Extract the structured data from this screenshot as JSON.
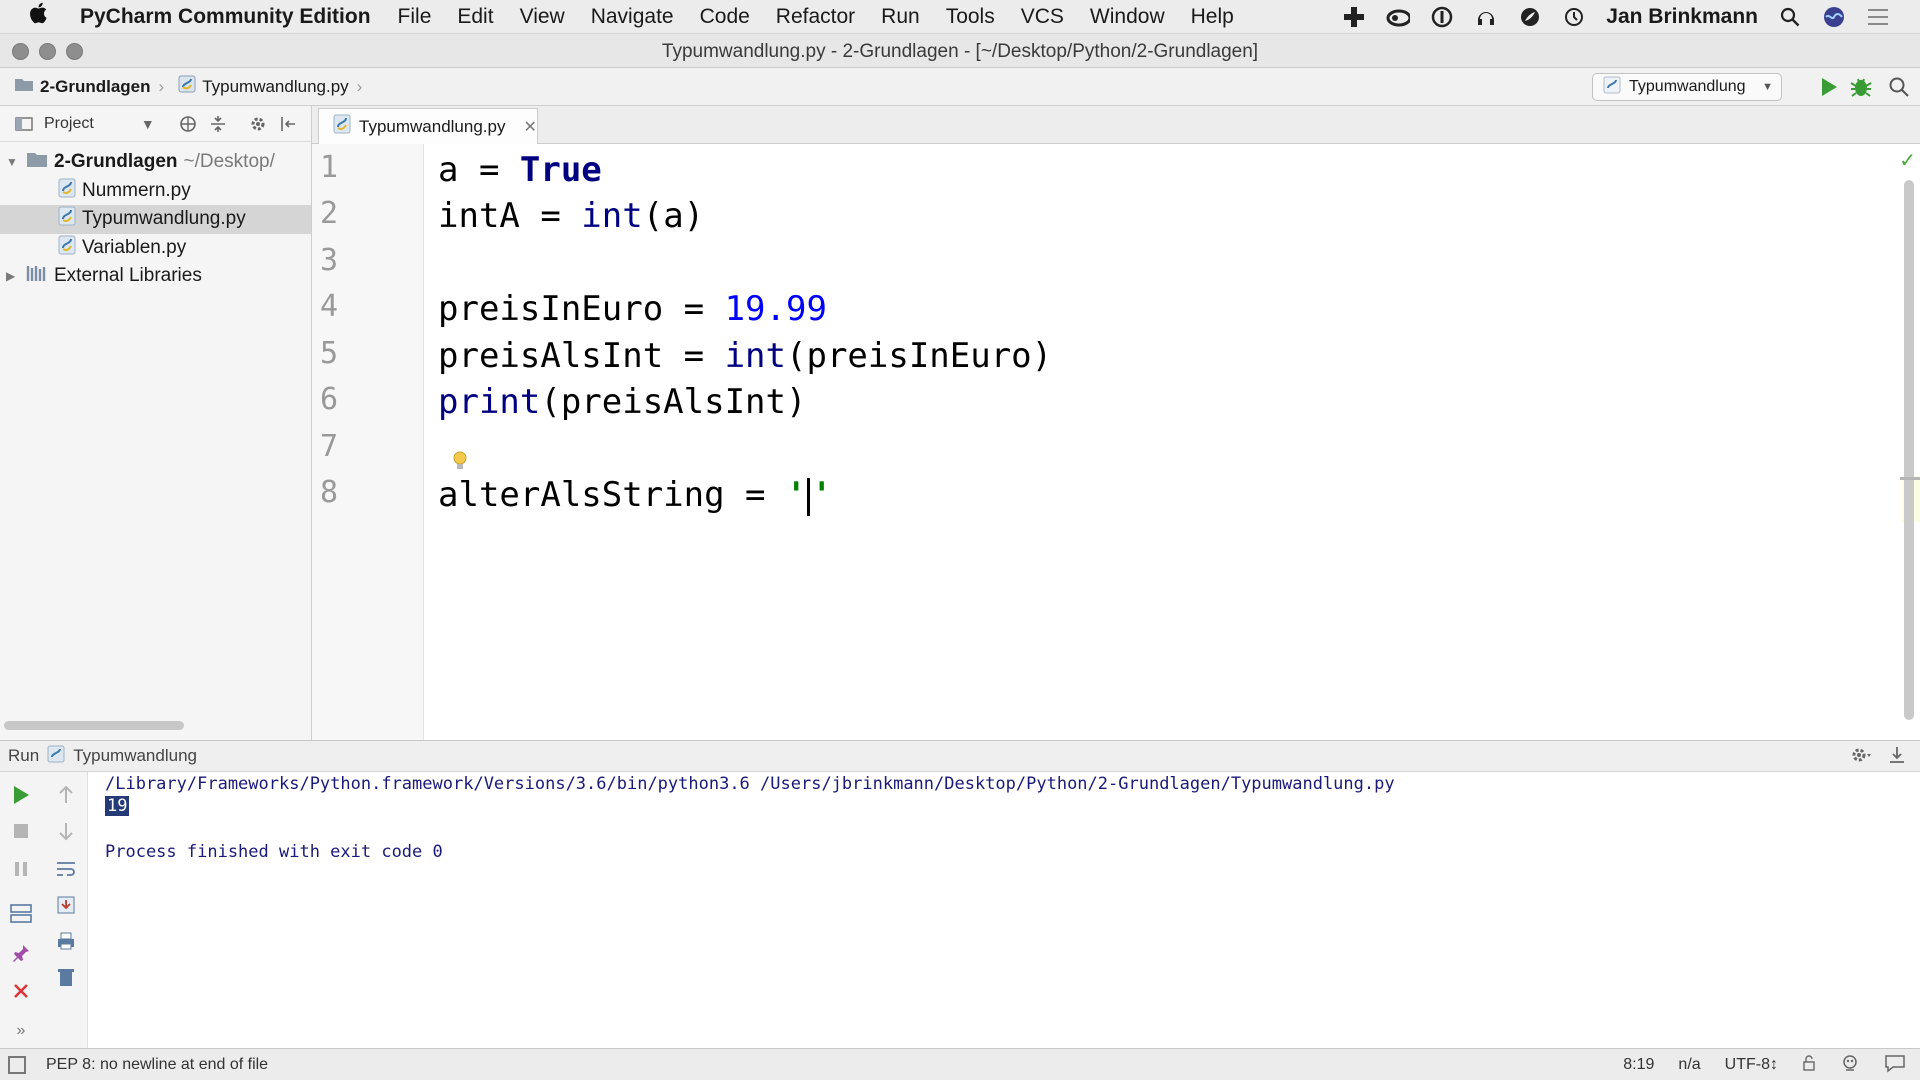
{
  "menubar": {
    "app_name": "PyCharm Community Edition",
    "items": [
      "File",
      "Edit",
      "View",
      "Navigate",
      "Code",
      "Refactor",
      "Run",
      "Tools",
      "VCS",
      "Window",
      "Help"
    ],
    "user": "Jan Brinkmann"
  },
  "window": {
    "title": "Typumwandlung.py - 2-Grundlagen - [~/Desktop/Python/2-Grundlagen]"
  },
  "navbar": {
    "breadcrumb": [
      "2-Grundlagen",
      "Typumwandlung.py"
    ],
    "run_config": "Typumwandlung"
  },
  "project_panel": {
    "label": "Project",
    "tree": [
      {
        "label": "2-Grundlagen",
        "path": "~/Desktop/"
      },
      {
        "label": "Nummern.py"
      },
      {
        "label": "Typumwandlung.py"
      },
      {
        "label": "Variablen.py"
      },
      {
        "label": "External Libraries"
      }
    ]
  },
  "editor": {
    "tab_label": "Typumwandlung.py",
    "line_numbers": [
      "1",
      "2",
      "3",
      "4",
      "5",
      "6",
      "7",
      "8"
    ],
    "lines": {
      "l1_var": "a = ",
      "l1_kw": "True",
      "l2_var": "intA = ",
      "l2_fn": "int",
      "l2_rest": "(a)",
      "l4_var": "preisInEuro = ",
      "l4_num": "19.99",
      "l5_var": "preisAlsInt = ",
      "l5_fn": "int",
      "l5_rest": "(preisInEuro)",
      "l6_fn": "print",
      "l6_rest": "(preisAlsInt)",
      "l8_var": "alterAlsString = ",
      "l8_q1": "'",
      "l8_q2": "'"
    }
  },
  "run_panel": {
    "label": "Run",
    "config": "Typumwandlung",
    "command": "/Library/Frameworks/Python.framework/Versions/3.6/bin/python3.6 /Users/jbrinkmann/Desktop/Python/2-Grundlagen/Typumwandlung.py",
    "output": "19",
    "exit_message": "Process finished with exit code 0"
  },
  "statusbar": {
    "message": "PEP 8: no newline at end of file",
    "position": "8:19",
    "separator": "n/a",
    "encoding": "UTF-8↕"
  },
  "colors": {
    "keyword": "#000080",
    "number": "#0000ff",
    "string": "#008000",
    "current_line": "#fdfde3",
    "run_green": "#3a9c34"
  }
}
